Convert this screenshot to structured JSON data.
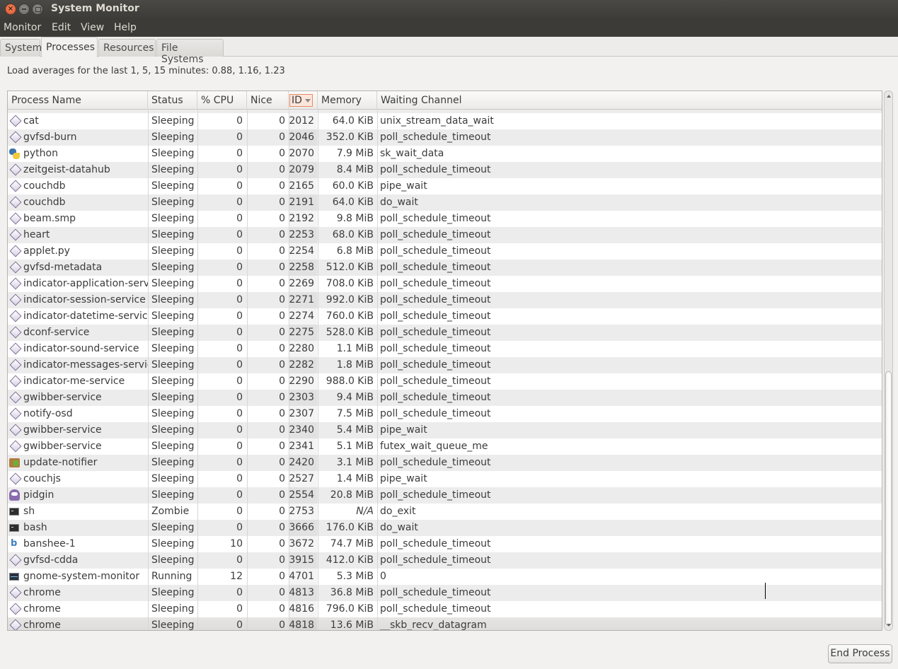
{
  "window": {
    "title": "System Monitor",
    "close_glyph": "×"
  },
  "menubar": [
    "Monitor",
    "Edit",
    "View",
    "Help"
  ],
  "tabs": [
    {
      "label": "System",
      "active": false
    },
    {
      "label": "Processes",
      "active": true
    },
    {
      "label": "Resources",
      "active": false
    },
    {
      "label": "File Systems",
      "active": false
    }
  ],
  "load_averages": "Load averages for the last 1, 5, 15 minutes: 0.88, 1.16, 1.23",
  "columns": {
    "name": "Process Name",
    "status": "Status",
    "cpu": "% CPU",
    "nice": "Nice",
    "id": "ID",
    "memory": "Memory",
    "waiting": "Waiting Channel",
    "sorted_by": "id",
    "sort_order": "descending-arrow"
  },
  "processes": [
    {
      "icon": "generic-process-icon",
      "name": "cat",
      "status": "Sleeping",
      "cpu": "0",
      "nice": "0",
      "id": "2012",
      "memory": "64.0 KiB",
      "waiting": "unix_stream_data_wait"
    },
    {
      "icon": "generic-process-icon",
      "name": "gvfsd-burn",
      "status": "Sleeping",
      "cpu": "0",
      "nice": "0",
      "id": "2046",
      "memory": "352.0 KiB",
      "waiting": "poll_schedule_timeout"
    },
    {
      "icon": "python-icon",
      "name": "python",
      "status": "Sleeping",
      "cpu": "0",
      "nice": "0",
      "id": "2070",
      "memory": "7.9 MiB",
      "waiting": "sk_wait_data"
    },
    {
      "icon": "generic-process-icon",
      "name": "zeitgeist-datahub",
      "status": "Sleeping",
      "cpu": "0",
      "nice": "0",
      "id": "2079",
      "memory": "8.4 MiB",
      "waiting": "poll_schedule_timeout"
    },
    {
      "icon": "generic-process-icon",
      "name": "couchdb",
      "status": "Sleeping",
      "cpu": "0",
      "nice": "0",
      "id": "2165",
      "memory": "60.0 KiB",
      "waiting": "pipe_wait"
    },
    {
      "icon": "generic-process-icon",
      "name": "couchdb",
      "status": "Sleeping",
      "cpu": "0",
      "nice": "0",
      "id": "2191",
      "memory": "64.0 KiB",
      "waiting": "do_wait"
    },
    {
      "icon": "generic-process-icon",
      "name": "beam.smp",
      "status": "Sleeping",
      "cpu": "0",
      "nice": "0",
      "id": "2192",
      "memory": "9.8 MiB",
      "waiting": "poll_schedule_timeout"
    },
    {
      "icon": "generic-process-icon",
      "name": "heart",
      "status": "Sleeping",
      "cpu": "0",
      "nice": "0",
      "id": "2253",
      "memory": "68.0 KiB",
      "waiting": "poll_schedule_timeout"
    },
    {
      "icon": "generic-process-icon",
      "name": "applet.py",
      "status": "Sleeping",
      "cpu": "0",
      "nice": "0",
      "id": "2254",
      "memory": "6.8 MiB",
      "waiting": "poll_schedule_timeout"
    },
    {
      "icon": "generic-process-icon",
      "name": "gvfsd-metadata",
      "status": "Sleeping",
      "cpu": "0",
      "nice": "0",
      "id": "2258",
      "memory": "512.0 KiB",
      "waiting": "poll_schedule_timeout"
    },
    {
      "icon": "generic-process-icon",
      "name": "indicator-application-service",
      "status": "Sleeping",
      "cpu": "0",
      "nice": "0",
      "id": "2269",
      "memory": "708.0 KiB",
      "waiting": "poll_schedule_timeout"
    },
    {
      "icon": "generic-process-icon",
      "name": "indicator-session-service",
      "status": "Sleeping",
      "cpu": "0",
      "nice": "0",
      "id": "2271",
      "memory": "992.0 KiB",
      "waiting": "poll_schedule_timeout"
    },
    {
      "icon": "generic-process-icon",
      "name": "indicator-datetime-service",
      "status": "Sleeping",
      "cpu": "0",
      "nice": "0",
      "id": "2274",
      "memory": "760.0 KiB",
      "waiting": "poll_schedule_timeout"
    },
    {
      "icon": "generic-process-icon",
      "name": "dconf-service",
      "status": "Sleeping",
      "cpu": "0",
      "nice": "0",
      "id": "2275",
      "memory": "528.0 KiB",
      "waiting": "poll_schedule_timeout"
    },
    {
      "icon": "generic-process-icon",
      "name": "indicator-sound-service",
      "status": "Sleeping",
      "cpu": "0",
      "nice": "0",
      "id": "2280",
      "memory": "1.1 MiB",
      "waiting": "poll_schedule_timeout"
    },
    {
      "icon": "generic-process-icon",
      "name": "indicator-messages-service",
      "status": "Sleeping",
      "cpu": "0",
      "nice": "0",
      "id": "2282",
      "memory": "1.8 MiB",
      "waiting": "poll_schedule_timeout"
    },
    {
      "icon": "generic-process-icon",
      "name": "indicator-me-service",
      "status": "Sleeping",
      "cpu": "0",
      "nice": "0",
      "id": "2290",
      "memory": "988.0 KiB",
      "waiting": "poll_schedule_timeout"
    },
    {
      "icon": "generic-process-icon",
      "name": "gwibber-service",
      "status": "Sleeping",
      "cpu": "0",
      "nice": "0",
      "id": "2303",
      "memory": "9.4 MiB",
      "waiting": "poll_schedule_timeout"
    },
    {
      "icon": "generic-process-icon",
      "name": "notify-osd",
      "status": "Sleeping",
      "cpu": "0",
      "nice": "0",
      "id": "2307",
      "memory": "7.5 MiB",
      "waiting": "poll_schedule_timeout"
    },
    {
      "icon": "generic-process-icon",
      "name": "gwibber-service",
      "status": "Sleeping",
      "cpu": "0",
      "nice": "0",
      "id": "2340",
      "memory": "5.4 MiB",
      "waiting": "pipe_wait"
    },
    {
      "icon": "generic-process-icon",
      "name": "gwibber-service",
      "status": "Sleeping",
      "cpu": "0",
      "nice": "0",
      "id": "2341",
      "memory": "5.1 MiB",
      "waiting": "futex_wait_queue_me"
    },
    {
      "icon": "update-notifier-icon",
      "name": "update-notifier",
      "status": "Sleeping",
      "cpu": "0",
      "nice": "0",
      "id": "2420",
      "memory": "3.1 MiB",
      "waiting": "poll_schedule_timeout"
    },
    {
      "icon": "generic-process-icon",
      "name": "couchjs",
      "status": "Sleeping",
      "cpu": "0",
      "nice": "0",
      "id": "2527",
      "memory": "1.4 MiB",
      "waiting": "pipe_wait"
    },
    {
      "icon": "pidgin-icon",
      "name": "pidgin",
      "status": "Sleeping",
      "cpu": "0",
      "nice": "0",
      "id": "2554",
      "memory": "20.8 MiB",
      "waiting": "poll_schedule_timeout"
    },
    {
      "icon": "terminal-icon",
      "name": "sh",
      "status": "Zombie",
      "cpu": "0",
      "nice": "0",
      "id": "2753",
      "memory": "N/A",
      "waiting": "do_exit"
    },
    {
      "icon": "terminal-icon",
      "name": "bash",
      "status": "Sleeping",
      "cpu": "0",
      "nice": "0",
      "id": "3666",
      "memory": "176.0 KiB",
      "waiting": "do_wait"
    },
    {
      "icon": "banshee-icon",
      "name": "banshee-1",
      "status": "Sleeping",
      "cpu": "10",
      "nice": "0",
      "id": "3672",
      "memory": "74.7 MiB",
      "waiting": "poll_schedule_timeout"
    },
    {
      "icon": "generic-process-icon",
      "name": "gvfsd-cdda",
      "status": "Sleeping",
      "cpu": "0",
      "nice": "0",
      "id": "3915",
      "memory": "412.0 KiB",
      "waiting": "poll_schedule_timeout"
    },
    {
      "icon": "system-monitor-icon",
      "name": "gnome-system-monitor",
      "status": "Running",
      "cpu": "12",
      "nice": "0",
      "id": "4701",
      "memory": "5.3 MiB",
      "waiting": "0"
    },
    {
      "icon": "generic-process-icon",
      "name": "chrome",
      "status": "Sleeping",
      "cpu": "0",
      "nice": "0",
      "id": "4813",
      "memory": "36.8 MiB",
      "waiting": "poll_schedule_timeout"
    },
    {
      "icon": "generic-process-icon",
      "name": "chrome",
      "status": "Sleeping",
      "cpu": "0",
      "nice": "0",
      "id": "4816",
      "memory": "796.0 KiB",
      "waiting": "poll_schedule_timeout"
    },
    {
      "icon": "generic-process-icon",
      "name": "chrome",
      "status": "Sleeping",
      "cpu": "0",
      "nice": "0",
      "id": "4818",
      "memory": "13.6 MiB",
      "waiting": "__skb_recv_datagram"
    }
  ],
  "scroll_position_fraction": 0.5,
  "buttons": {
    "end_process": "End Process"
  }
}
